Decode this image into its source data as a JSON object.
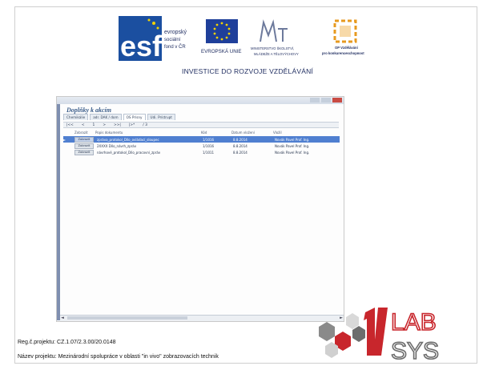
{
  "header": {
    "esf_logo_text": [
      "evropský",
      "sociální",
      "fond v ČR"
    ],
    "eu_logo_text": "EVROPSKÁ UNIE",
    "msmt_logo_text": [
      "MINISTERSTVO ŠKOLSTVÍ,",
      "MLÁDEŽE A TĚLOVÝCHOVY"
    ],
    "op_logo_text": [
      "OP Vzdělávání",
      "pro konkurenceschopnost"
    ],
    "tagline": "INVESTICE DO ROZVOJE VZDĚLÁVÁNÍ"
  },
  "screenshot": {
    "form_title": "Doplňky k akcím",
    "tabs": [
      "Chemikálie",
      "adr. DAK / dom",
      "OS Prísny",
      "Udi. Prístrupt"
    ],
    "nav": {
      "first": "|<<",
      "prev": "<",
      "position": "1",
      "next": ">",
      "last": ">>|",
      "new": "|>*",
      "count": "/ 3"
    },
    "columns": [
      "Zobrazit",
      "Popis dokumentu",
      "Kód",
      "Datum vložení",
      "Vložil"
    ],
    "rows": [
      {
        "button": "Zobrazit",
        "desc": "zpráva_protokol_Dílo_ovládací_sloupec",
        "code": "1/1016",
        "date": "8.8.2014",
        "user": "Novák Pavel Prof. Ing."
      },
      {
        "button": "Zobrazit",
        "desc": "2XXXX Dílo_návrh_zpráv",
        "code": "1/1016",
        "date": "8.8.2014",
        "user": "Novák Pavel Prof. Ing."
      },
      {
        "button": "Zobrazit",
        "desc": "návrhové_protokol_Dílo_pracovní_zpráv",
        "code": "1/1011",
        "date": "8.8.2014",
        "user": "Novák Pavel Prof. Ing."
      }
    ]
  },
  "footer": {
    "reg": "Reg.č.projektu: CZ.1.07/2.3.00/20.0148",
    "nazev": "Název projektu: Mezinárodní spolupráce v oblasti \"in vivo\" zobrazovacích technik",
    "lab_text": "LAB",
    "sys_text": "SYS"
  },
  "colors": {
    "esf_blue": "#1b4fa0",
    "eu_blue": "#1f3f9a",
    "eu_star": "#f2d200",
    "op_orange": "#e79a1f",
    "lab_red": "#c8262c",
    "lab_gray": "#6d6d6d",
    "selection": "#4f7fd0"
  }
}
